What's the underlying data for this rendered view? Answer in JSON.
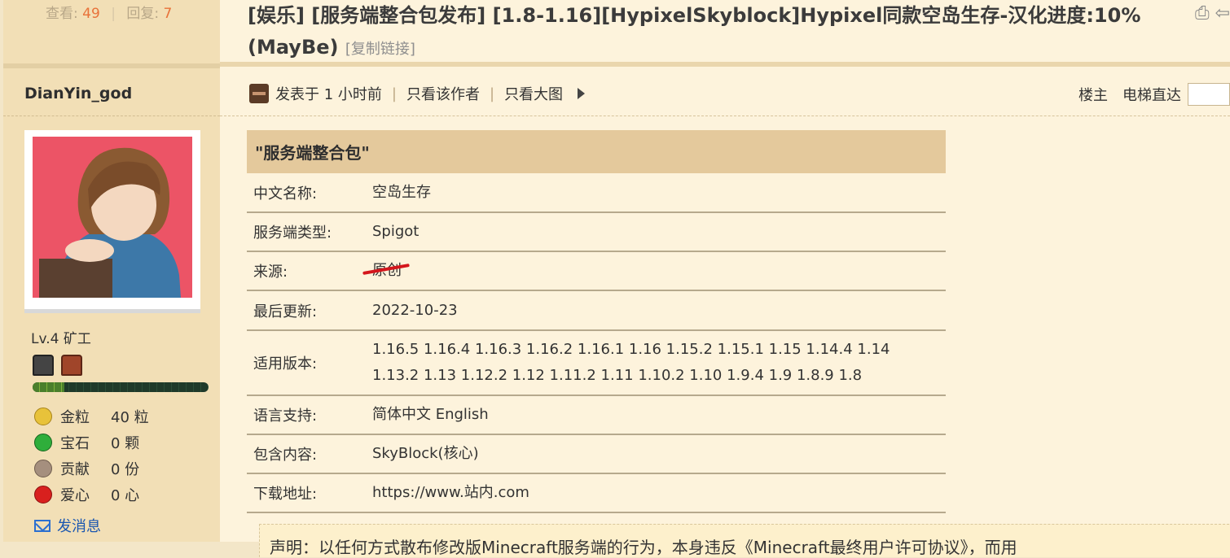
{
  "thread": {
    "views_label": "查看:",
    "views": "49",
    "replies_label": "回复:",
    "replies": "7",
    "title": "[娱乐] [服务端整合包发布] [1.8-1.16][HypixelSkyblock]Hypixel同款空岛生存-汉化进度:10%(MayBe)",
    "copy_link": "[复制链接]"
  },
  "author": {
    "name": "DianYin_god",
    "level": "Lv.4 矿工",
    "exp_fraction": 0.18,
    "assets": [
      {
        "name": "金粒",
        "value": "40 粒",
        "color": "#e8c23a"
      },
      {
        "name": "宝石",
        "value": "0 颗",
        "color": "#2fae3b"
      },
      {
        "name": "贡献",
        "value": "0 份",
        "color": "#a58f7e"
      },
      {
        "name": "爱心",
        "value": "0 心",
        "color": "#d8201e"
      }
    ],
    "send_message": "发消息"
  },
  "post": {
    "posted": "发表于 1 小时前",
    "only_author": "只看该作者",
    "only_images": "只看大图",
    "floor": "楼主",
    "jump": "电梯直达"
  },
  "info_table": {
    "heading": "\"服务端整合包\"",
    "rows": [
      {
        "key": "中文名称:",
        "value": "空岛生存"
      },
      {
        "key": "服务端类型:",
        "value": "Spigot"
      },
      {
        "key": "来源:",
        "value": "原创"
      },
      {
        "key": "最后更新:",
        "value": "2022-10-23"
      },
      {
        "key": "适用版本:",
        "value": "1.16.5 1.16.4 1.16.3 1.16.2 1.16.1 1.16 1.15.2 1.15.1 1.15 1.14.4 1.14 1.13.2 1.13 1.12.2 1.12 1.11.2 1.11 1.10.2 1.10 1.9.4 1.9 1.8.9 1.8"
      },
      {
        "key": "语言支持:",
        "value": "简体中文 English"
      },
      {
        "key": "包含内容:",
        "value": "SkyBlock(核心)"
      },
      {
        "key": "下载地址:",
        "value": "https://www.站内.com"
      }
    ]
  },
  "notice": {
    "text": "声明：以任何方式散布修改版Minecraft服务端的行为，本身违反《Minecraft最终用户许可协议》，而用"
  }
}
